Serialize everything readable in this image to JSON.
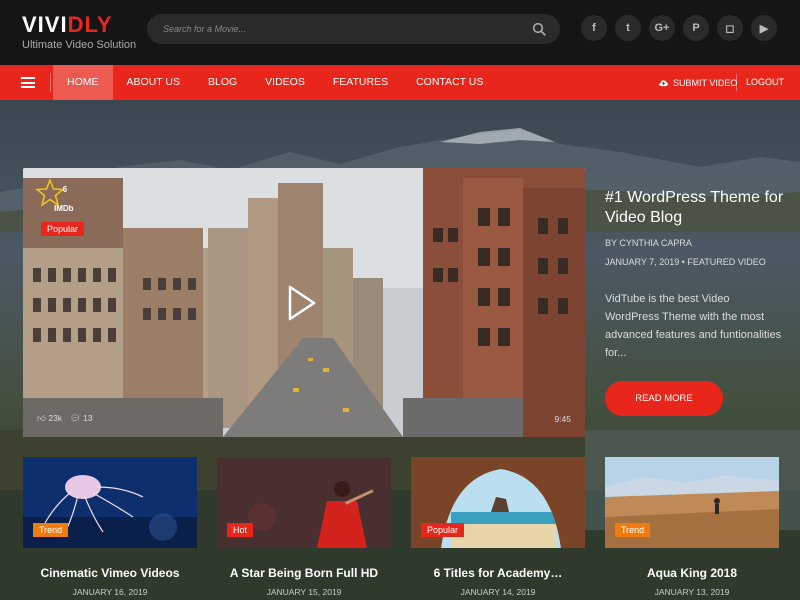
{
  "logo": {
    "part1": "VIVI",
    "part2": "DLY",
    "tagline": "Ultimate Video Solution"
  },
  "search": {
    "placeholder": "Search for a Movie..."
  },
  "socials": [
    {
      "icon": "facebook-icon",
      "glyph": "f"
    },
    {
      "icon": "twitter-icon",
      "glyph": "t"
    },
    {
      "icon": "google-plus-icon",
      "glyph": "G+"
    },
    {
      "icon": "pinterest-icon",
      "glyph": "P"
    },
    {
      "icon": "instagram-icon",
      "glyph": "◻"
    },
    {
      "icon": "youtube-icon",
      "glyph": "▶"
    }
  ],
  "nav": {
    "items": [
      "HOME",
      "ABOUT US",
      "BLOG",
      "VIDEOS",
      "FEATURES",
      "CONTACT US"
    ],
    "submit_label": "SUBMIT VIDEO",
    "logout_label": "LOGOUT"
  },
  "featured": {
    "imdb_score": "6",
    "imdb_label": "IMDb",
    "badge": "Popular",
    "likes": "23k",
    "comments": "13",
    "duration": "9:45",
    "title": "#1 WordPress Theme for Video Blog",
    "author": "BY CYNTHIA CAPRA",
    "date": "JANUARY 7, 2019",
    "category": "FEATURED VIDEO",
    "excerpt": "VidTube is the best Video WordPress Theme with the most advanced features and funtionalities for...",
    "button": "READ MORE"
  },
  "cards": [
    {
      "badge": "Trend",
      "title": "Cinematic Vimeo Videos",
      "date": "JANUARY 16, 2019"
    },
    {
      "badge": "Hot",
      "title": "A Star Being Born Full HD",
      "date": "JANUARY 15, 2019"
    },
    {
      "badge": "Popular",
      "title": "6 Titles for Academy…",
      "date": "JANUARY 14, 2019"
    },
    {
      "badge": "Trend",
      "title": "Aqua King 2018",
      "date": "JANUARY 13, 2019"
    }
  ],
  "colors": {
    "accent": "#e8261b",
    "trend": "#f07c0f",
    "header_bg": "#151515"
  }
}
